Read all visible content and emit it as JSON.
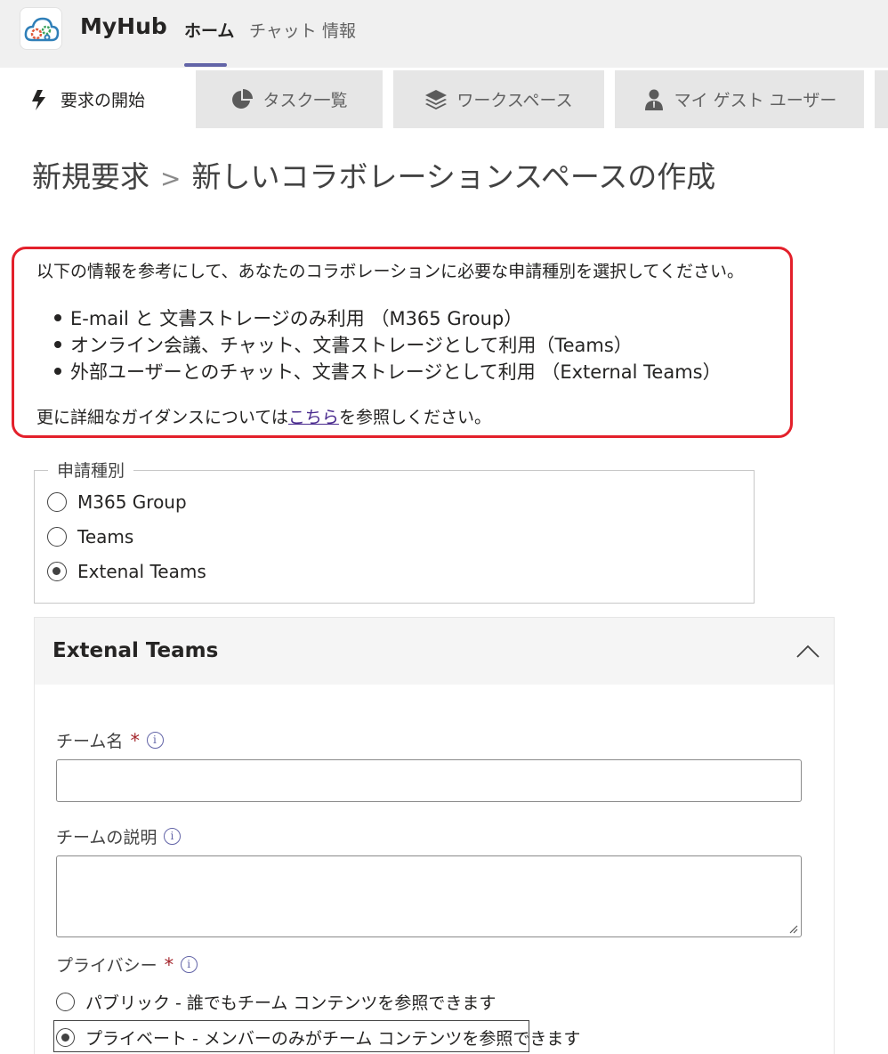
{
  "app": {
    "title": "MyHub",
    "nav": [
      "ホーム",
      "チャット",
      "情報"
    ]
  },
  "tabs": [
    {
      "label": "要求の開始",
      "icon": "lightning-icon"
    },
    {
      "label": "タスク一覧",
      "icon": "pie-chart-icon"
    },
    {
      "label": "ワークスペース",
      "icon": "layers-icon"
    },
    {
      "label": "マイ ゲスト ユーザー",
      "icon": "person-icon"
    }
  ],
  "breadcrumb": {
    "parent": "新規要求",
    "separator": ">",
    "current": "新しいコラボレーションスペースの作成"
  },
  "info": {
    "intro": "以下の情報を参考にして、あなたのコラボレーションに必要な申請種別を選択してください。",
    "items": [
      "E-mail と 文書ストレージのみ利用 （M365 Group）",
      "オンライン会議、チャット、文書ストレージとして利用（Teams）",
      "外部ユーザーとのチャット、文書ストレージとして利用 （External Teams）"
    ],
    "guide_prefix": "更に詳細なガイダンスについては",
    "guide_link": "こちら",
    "guide_suffix": "を参照しください。"
  },
  "request_type": {
    "legend": "申請種別",
    "options": [
      "M365 Group",
      "Teams",
      "Extenal Teams"
    ],
    "selected": "Extenal Teams"
  },
  "section": {
    "title": "Extenal Teams",
    "team_name_label": "チーム名",
    "team_name_value": "",
    "team_desc_label": "チームの説明",
    "team_desc_value": "",
    "privacy_label": "プライバシー",
    "required_mark": "*",
    "privacy_options": [
      "パブリック - 誰でもチーム コンテンツを参照できます",
      "プライベート - メンバーのみがチーム コンテンツを参照できます"
    ],
    "privacy_selected": "プライベート - メンバーのみがチーム コンテンツを参照できます"
  },
  "colors": {
    "accent": "#6264a7",
    "highlight_border": "#e3202b",
    "required": "#a4262c"
  }
}
